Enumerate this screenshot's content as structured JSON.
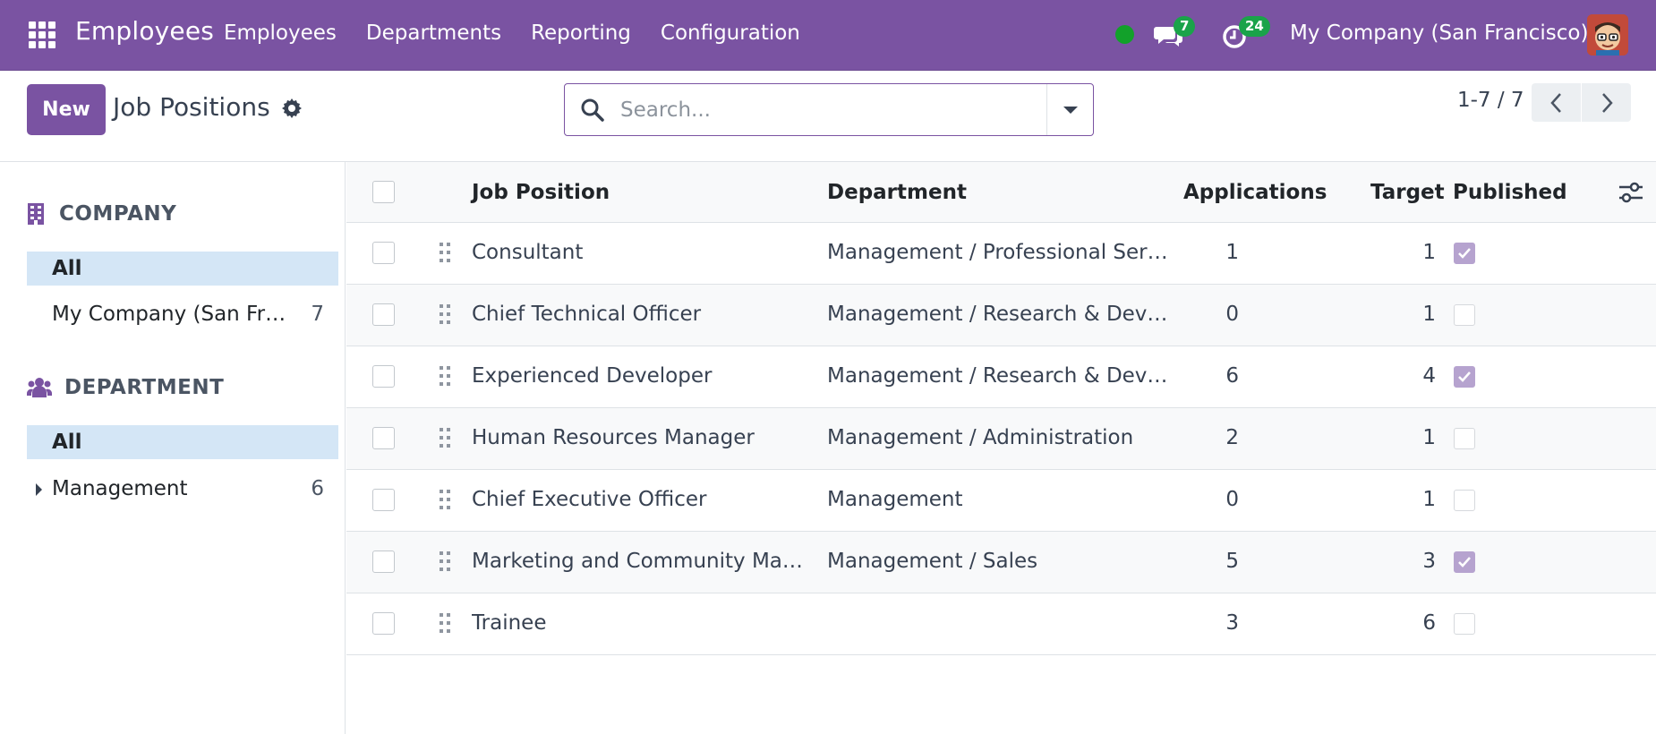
{
  "navbar": {
    "brand": "Employees",
    "menu": [
      "Employees",
      "Departments",
      "Reporting",
      "Configuration"
    ],
    "chat_count": "7",
    "activity_count": "24",
    "company": "My Company (San Francisco)",
    "status_color": "#12a12a",
    "accent_color": "#7a53a2"
  },
  "control_panel": {
    "new_label": "New",
    "title": "Job Positions",
    "search_placeholder": "Search...",
    "pager": "1-7 / 7"
  },
  "sidebar": {
    "company_header": "COMPANY",
    "company_items": [
      {
        "label": "All",
        "count": ""
      },
      {
        "label": "My Company (San Fran…",
        "count": "7"
      }
    ],
    "department_header": "DEPARTMENT",
    "department_items": [
      {
        "label": "All",
        "count": ""
      },
      {
        "label": "Management",
        "count": "6"
      }
    ]
  },
  "table": {
    "headers": {
      "job_position": "Job Position",
      "department": "Department",
      "applications": "Applications",
      "target": "Target",
      "published": "Published"
    },
    "rows": [
      {
        "job": "Consultant",
        "department": "Management / Professional Ser…",
        "applications": "1",
        "target": "1",
        "published": true
      },
      {
        "job": "Chief Technical Officer",
        "department": "Management / Research & Deve…",
        "applications": "0",
        "target": "1",
        "published": false
      },
      {
        "job": "Experienced Developer",
        "department": "Management / Research & Deve…",
        "applications": "6",
        "target": "4",
        "published": true
      },
      {
        "job": "Human Resources Manager",
        "department": "Management / Administration",
        "applications": "2",
        "target": "1",
        "published": false
      },
      {
        "job": "Chief Executive Officer",
        "department": "Management",
        "applications": "0",
        "target": "1",
        "published": false
      },
      {
        "job": "Marketing and Community Man…",
        "department": "Management / Sales",
        "applications": "5",
        "target": "3",
        "published": true
      },
      {
        "job": "Trainee",
        "department": "",
        "applications": "3",
        "target": "6",
        "published": false
      }
    ]
  }
}
